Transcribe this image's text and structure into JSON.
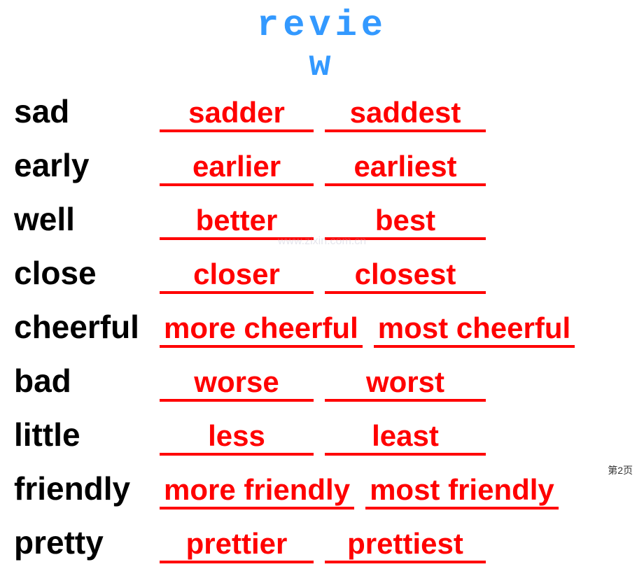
{
  "title": {
    "line1": "revie",
    "line2": "w"
  },
  "rows": [
    {
      "base": "sad",
      "comparative": "sadder",
      "superlative": "saddest"
    },
    {
      "base": "early",
      "comparative": "earlier",
      "superlative": "earliest"
    },
    {
      "base": "well",
      "comparative": "better",
      "superlative": "best"
    },
    {
      "base": "close",
      "comparative": "closer",
      "superlative": "closest"
    },
    {
      "base": "cheerful",
      "comparative": "more cheerful",
      "superlative": "most cheerful"
    },
    {
      "base": "bad",
      "comparative": "worse",
      "superlative": "worst"
    },
    {
      "base": "little",
      "comparative": "less",
      "superlative": "least"
    },
    {
      "base": "friendly",
      "comparative": "more friendly",
      "superlative": "most friendly"
    },
    {
      "base": "pretty",
      "comparative": "prettier",
      "superlative": "prettiest"
    }
  ],
  "watermark": "www.zixin.com.cn",
  "page": "第2页"
}
